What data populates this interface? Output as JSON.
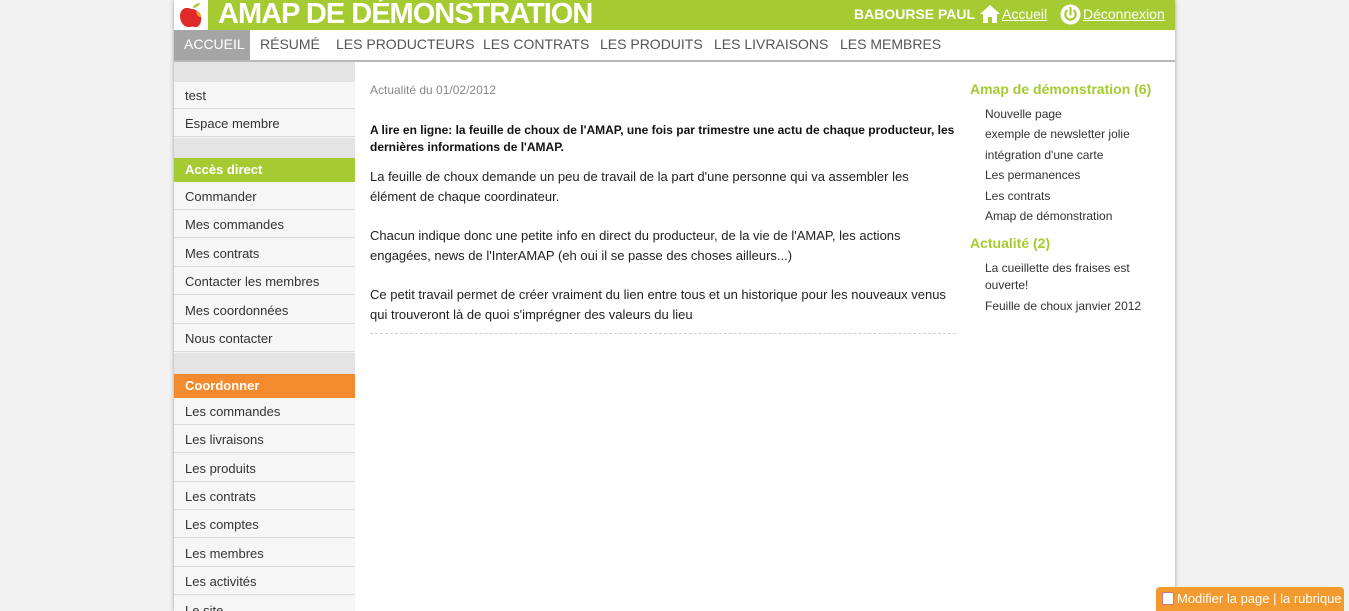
{
  "header": {
    "site_title": "AMAP DE DÉMONSTRATION",
    "user_name": "BABOURSE PAUL",
    "home_link": "Accueil",
    "logout_link": "Déconnexion",
    "brand_color": "#a6cb32"
  },
  "nav": {
    "tabs": [
      {
        "label": "ACCUEIL",
        "active": true
      },
      {
        "label": "RÉSUMÉ"
      },
      {
        "label": "LES PRODUCTEURS"
      },
      {
        "label": "LES CONTRATS"
      },
      {
        "label": "LES PRODUITS"
      },
      {
        "label": "LES LIVRAISONS"
      },
      {
        "label": "LES MEMBRES"
      }
    ]
  },
  "sidebar": {
    "top_items": [
      "test",
      "Espace membre"
    ],
    "acces_direct": {
      "title": "Accès direct",
      "color": "#a6cb32",
      "items": [
        "Commander",
        "Mes commandes",
        "Mes contrats",
        "Contacter les membres",
        "Mes coordonnées",
        "Nous contacter"
      ]
    },
    "coordonner": {
      "title": "Coordonner",
      "color": "#f38a2e",
      "items": [
        "Les commandes",
        "Les livraisons",
        "Les produits",
        "Les contrats",
        "Les comptes",
        "Les membres",
        "Les activités",
        "Le site"
      ]
    }
  },
  "main": {
    "date": "Actualité du 01/02/2012",
    "lead": "A lire en ligne: la feuille de choux de l'AMAP, une fois par trimestre une actu de chaque producteur, les dernières informations de l'AMAP.",
    "paragraphs": [
      "La feuille de choux demande un peu de travail de la part d'une personne qui va assembler les élément de chaque coordinateur.",
      "Chacun indique donc une petite info en direct du producteur, de la vie de l'AMAP, les actions engagées, news de l'InterAMAP (eh oui il se passe des choses ailleurs...)",
      "Ce petit travail permet de créer vraiment du lien entre tous et un historique pour les nouveaux venus qui trouveront là de quoi s'imprégner des valeurs du lieu"
    ]
  },
  "right": {
    "section1": {
      "title": "Amap de démonstration (6)",
      "links": [
        "Nouvelle page",
        "exemple de newsletter jolie",
        "intégration d'une carte",
        "Les permanences",
        "Les contrats",
        "Amap de démonstration"
      ]
    },
    "section2": {
      "title": "Actualité (2)",
      "links": [
        "La cueillette des fraises est ouverte!",
        "Feuille de choux janvier 2012"
      ]
    }
  },
  "edit_button": {
    "label": "Modifier la page | la rubrique",
    "color": "#f39a2e"
  }
}
